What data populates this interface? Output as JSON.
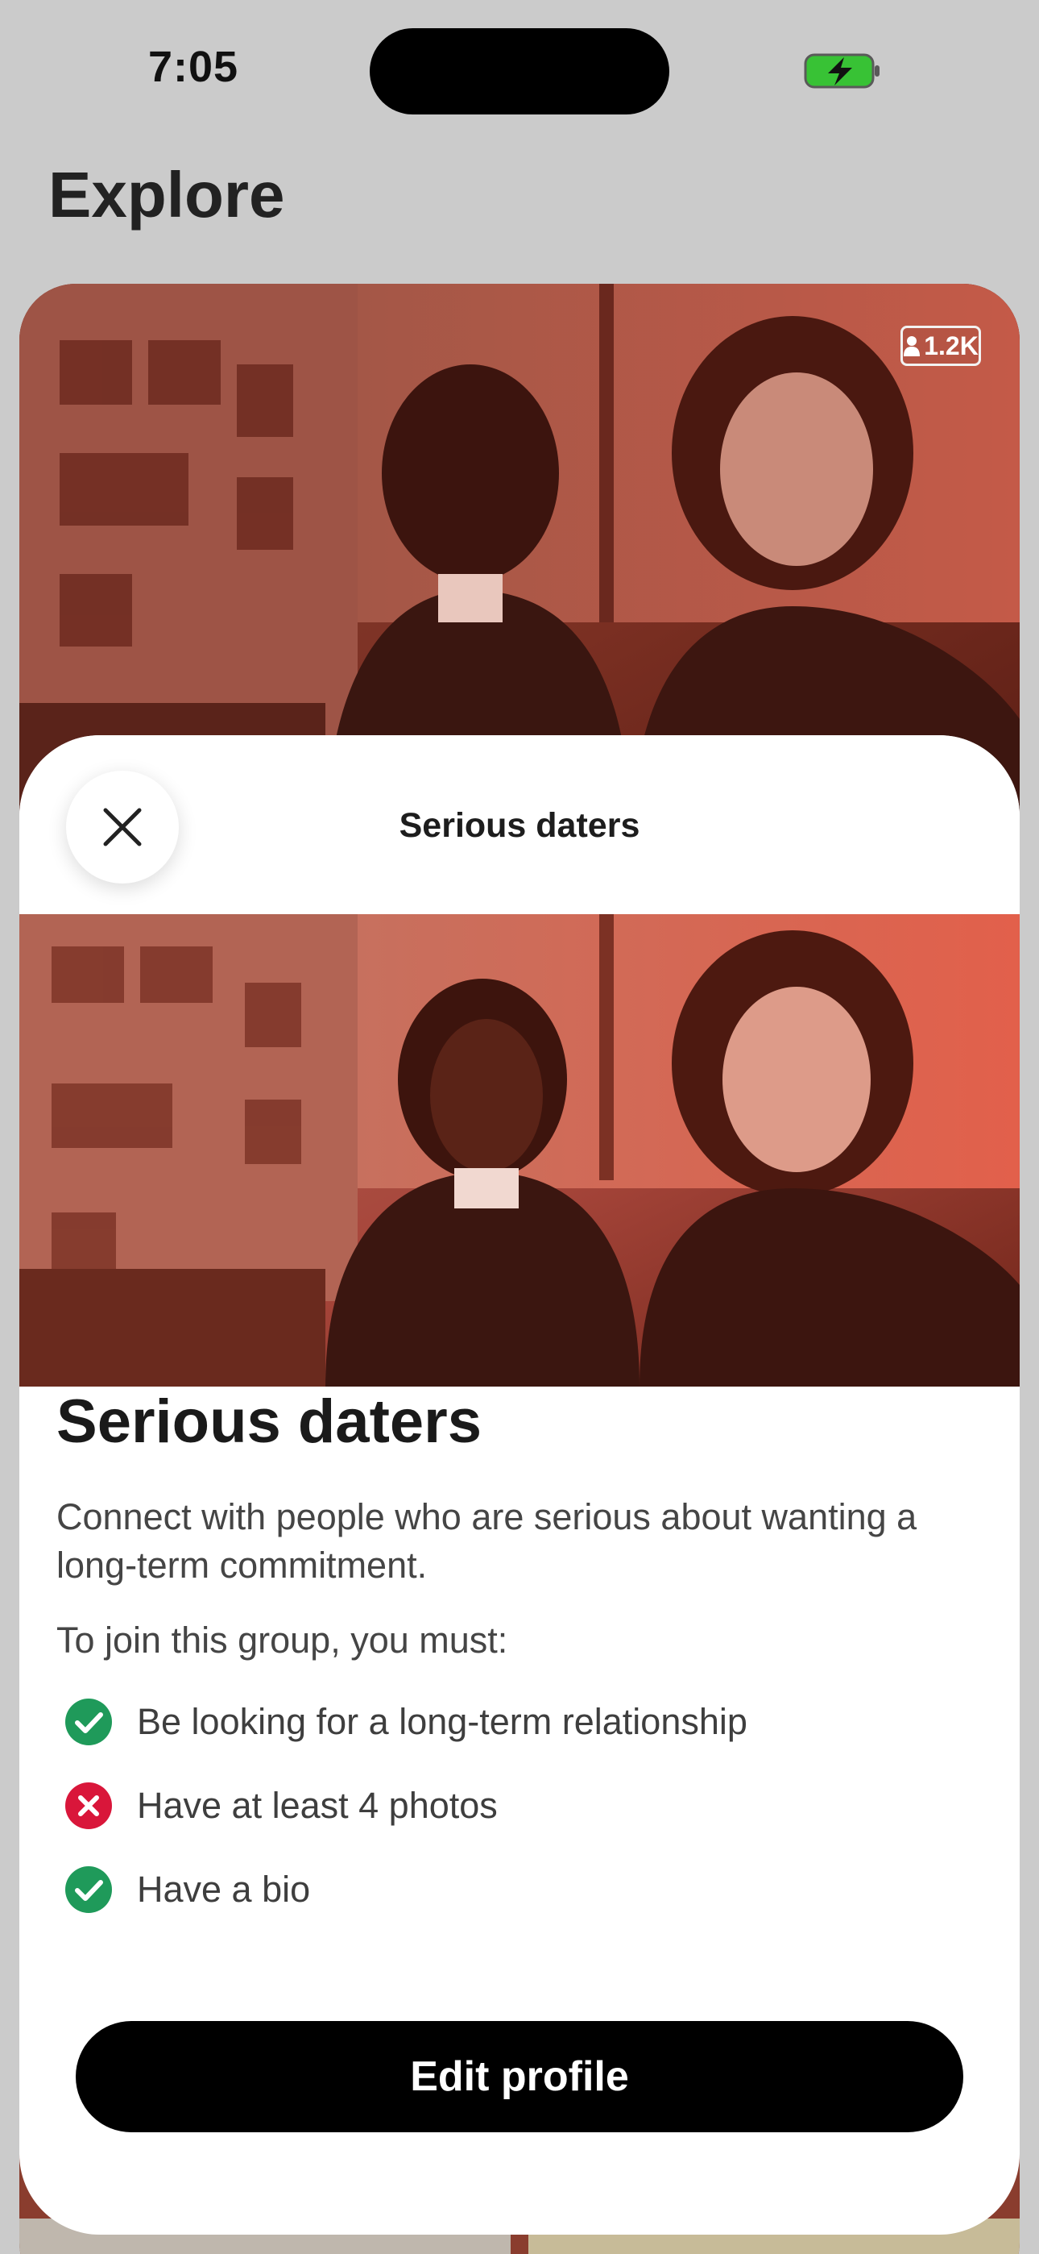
{
  "status_bar": {
    "time": "7:05",
    "battery_icon": "battery-charging-icon",
    "battery_color": "#38c235"
  },
  "page": {
    "title": "Explore"
  },
  "background_card": {
    "member_count": "1.2K",
    "member_icon": "person-icon"
  },
  "sheet": {
    "header_title": "Serious daters",
    "close_icon": "close-icon",
    "group_title": "Serious daters",
    "description": "Connect with people who are serious about wanting a long-term commitment.",
    "requirements_intro": "To join this group, you must:",
    "requirements": [
      {
        "label": "Be looking for a long-term relationship",
        "met": true,
        "icon": "check-circle-icon"
      },
      {
        "label": "Have at least 4 photos",
        "met": false,
        "icon": "x-circle-icon"
      },
      {
        "label": "Have a bio",
        "met": true,
        "icon": "check-circle-icon"
      }
    ],
    "primary_button": "Edit profile"
  },
  "colors": {
    "accent_photo_tint": "#c9523c",
    "success": "#1f9a5a",
    "error": "#d9163a",
    "button_background": "#000000"
  }
}
